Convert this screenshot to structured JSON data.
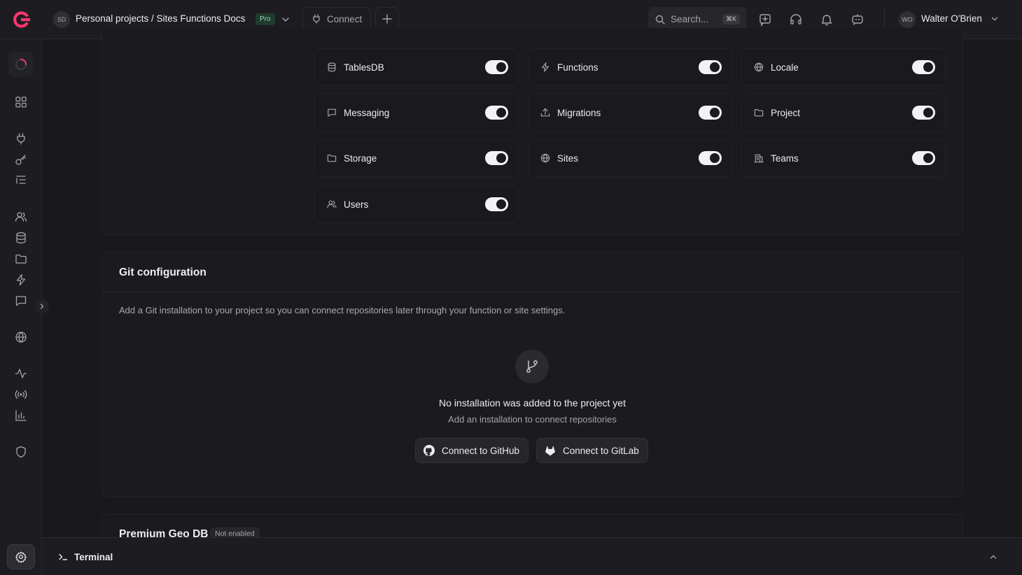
{
  "header": {
    "project_initials": "SD",
    "breadcrumb": "Personal projects / Sites Functions Docs",
    "plan_badge": "Pro",
    "connect_label": "Connect",
    "search_placeholder": "Search...",
    "search_shortcut": "⌘K",
    "user_initials": "WO",
    "user_name": "Walter O'Brien"
  },
  "services": [
    {
      "label": "TablesDB",
      "icon": "database-icon",
      "enabled": true
    },
    {
      "label": "Functions",
      "icon": "lightning-icon",
      "enabled": true
    },
    {
      "label": "Locale",
      "icon": "globe-icon",
      "enabled": true
    },
    {
      "label": "Messaging",
      "icon": "chat-icon",
      "enabled": true
    },
    {
      "label": "Migrations",
      "icon": "upload-icon",
      "enabled": true
    },
    {
      "label": "Project",
      "icon": "folder-icon",
      "enabled": true
    },
    {
      "label": "Storage",
      "icon": "folder-icon",
      "enabled": true
    },
    {
      "label": "Sites",
      "icon": "globe-icon",
      "enabled": true
    },
    {
      "label": "Teams",
      "icon": "building-icon",
      "enabled": true
    },
    {
      "label": "Users",
      "icon": "users-icon",
      "enabled": true
    }
  ],
  "git": {
    "title": "Git configuration",
    "description": "Add a Git installation to your project so you can connect repositories later through your function or site settings.",
    "empty_title": "No installation was added to the project yet",
    "empty_subtitle": "Add an installation to connect repositories",
    "github_label": "Connect to GitHub",
    "gitlab_label": "Connect to GitLab"
  },
  "geo": {
    "title": "Premium Geo DB",
    "badge": "Not enabled"
  },
  "terminal": {
    "label": "Terminal"
  },
  "colors": {
    "background": "#19191c",
    "accent": "#fd366e",
    "pro_badge": "#8fd8b0"
  }
}
